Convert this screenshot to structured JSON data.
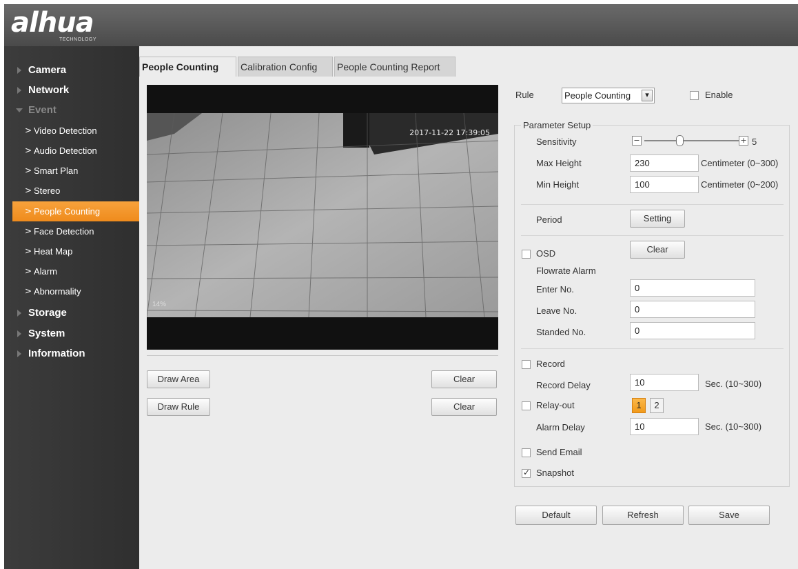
{
  "brand": {
    "logo": "alhua",
    "sub": "TECHNOLOGY"
  },
  "sidebar": {
    "top_items": [
      {
        "label": "Camera",
        "state": "collapsed"
      },
      {
        "label": "Network",
        "state": "collapsed"
      },
      {
        "label": "Event",
        "state": "expanded"
      },
      {
        "label": "Storage",
        "state": "collapsed"
      },
      {
        "label": "System",
        "state": "collapsed"
      },
      {
        "label": "Information",
        "state": "collapsed"
      }
    ],
    "event_sub_items": [
      {
        "label": "Video Detection",
        "active": false
      },
      {
        "label": "Audio Detection",
        "active": false
      },
      {
        "label": "Smart Plan",
        "active": false
      },
      {
        "label": "Stereo",
        "active": false
      },
      {
        "label": "People Counting",
        "active": true
      },
      {
        "label": "Face Detection",
        "active": false
      },
      {
        "label": "Heat Map",
        "active": false
      },
      {
        "label": "Alarm",
        "active": false
      },
      {
        "label": "Abnormality",
        "active": false
      }
    ],
    "chevron_glyph": ">"
  },
  "tabs": [
    {
      "label": "People Counting",
      "active": true
    },
    {
      "label": "Calibration Config",
      "active": false
    },
    {
      "label": "People Counting Report",
      "active": false
    }
  ],
  "video": {
    "timestamp": "2017-11-22 17:39:05",
    "overlay_mark": "14%"
  },
  "video_buttons": {
    "draw_area": "Draw Area",
    "draw_rule": "Draw Rule",
    "clear_area": "Clear",
    "clear_rule": "Clear"
  },
  "rule": {
    "label": "Rule",
    "value": "People Counting",
    "enable_label": "Enable",
    "enabled": false
  },
  "parameter_setup": {
    "legend": "Parameter Setup",
    "sensitivity_label": "Sensitivity",
    "sensitivity_value": 5,
    "sensitivity_value_text": "5",
    "sensitivity_max": 10,
    "max_height_label": "Max Height",
    "max_height_value": "230",
    "max_height_unit": "Centimeter (0~300)",
    "min_height_label": "Min Height",
    "min_height_value": "100",
    "min_height_unit": "Centimeter (0~200)",
    "period_label": "Period",
    "setting_button": "Setting",
    "osd_label": "OSD",
    "osd_checked": false,
    "osd_clear_button": "Clear",
    "flowrate_label": "Flowrate Alarm",
    "enter_label": "Enter No.",
    "enter_value": "0",
    "leave_label": "Leave No.",
    "leave_value": "0",
    "standed_label": "Standed No.",
    "standed_value": "0",
    "record_label": "Record",
    "record_checked": false,
    "record_delay_label": "Record Delay",
    "record_delay_value": "10",
    "record_delay_unit": "Sec. (10~300)",
    "relay_label": "Relay-out",
    "relay_checked": false,
    "relay_channels": [
      {
        "label": "1",
        "selected": true
      },
      {
        "label": "2",
        "selected": false
      }
    ],
    "alarm_delay_label": "Alarm Delay",
    "alarm_delay_value": "10",
    "alarm_delay_unit": "Sec. (10~300)",
    "send_email_label": "Send Email",
    "send_email_checked": false,
    "snapshot_label": "Snapshot",
    "snapshot_checked": true
  },
  "footer_buttons": {
    "default": "Default",
    "refresh": "Refresh",
    "save": "Save"
  },
  "icons": {
    "check_glyph": "✓",
    "minus_glyph": "−",
    "plus_glyph": "+",
    "dropdown_glyph": "▾"
  },
  "colors": {
    "accent": "#f19a1a",
    "sidebar_bg": "#333333",
    "header_bg": "#5a5a5a"
  }
}
